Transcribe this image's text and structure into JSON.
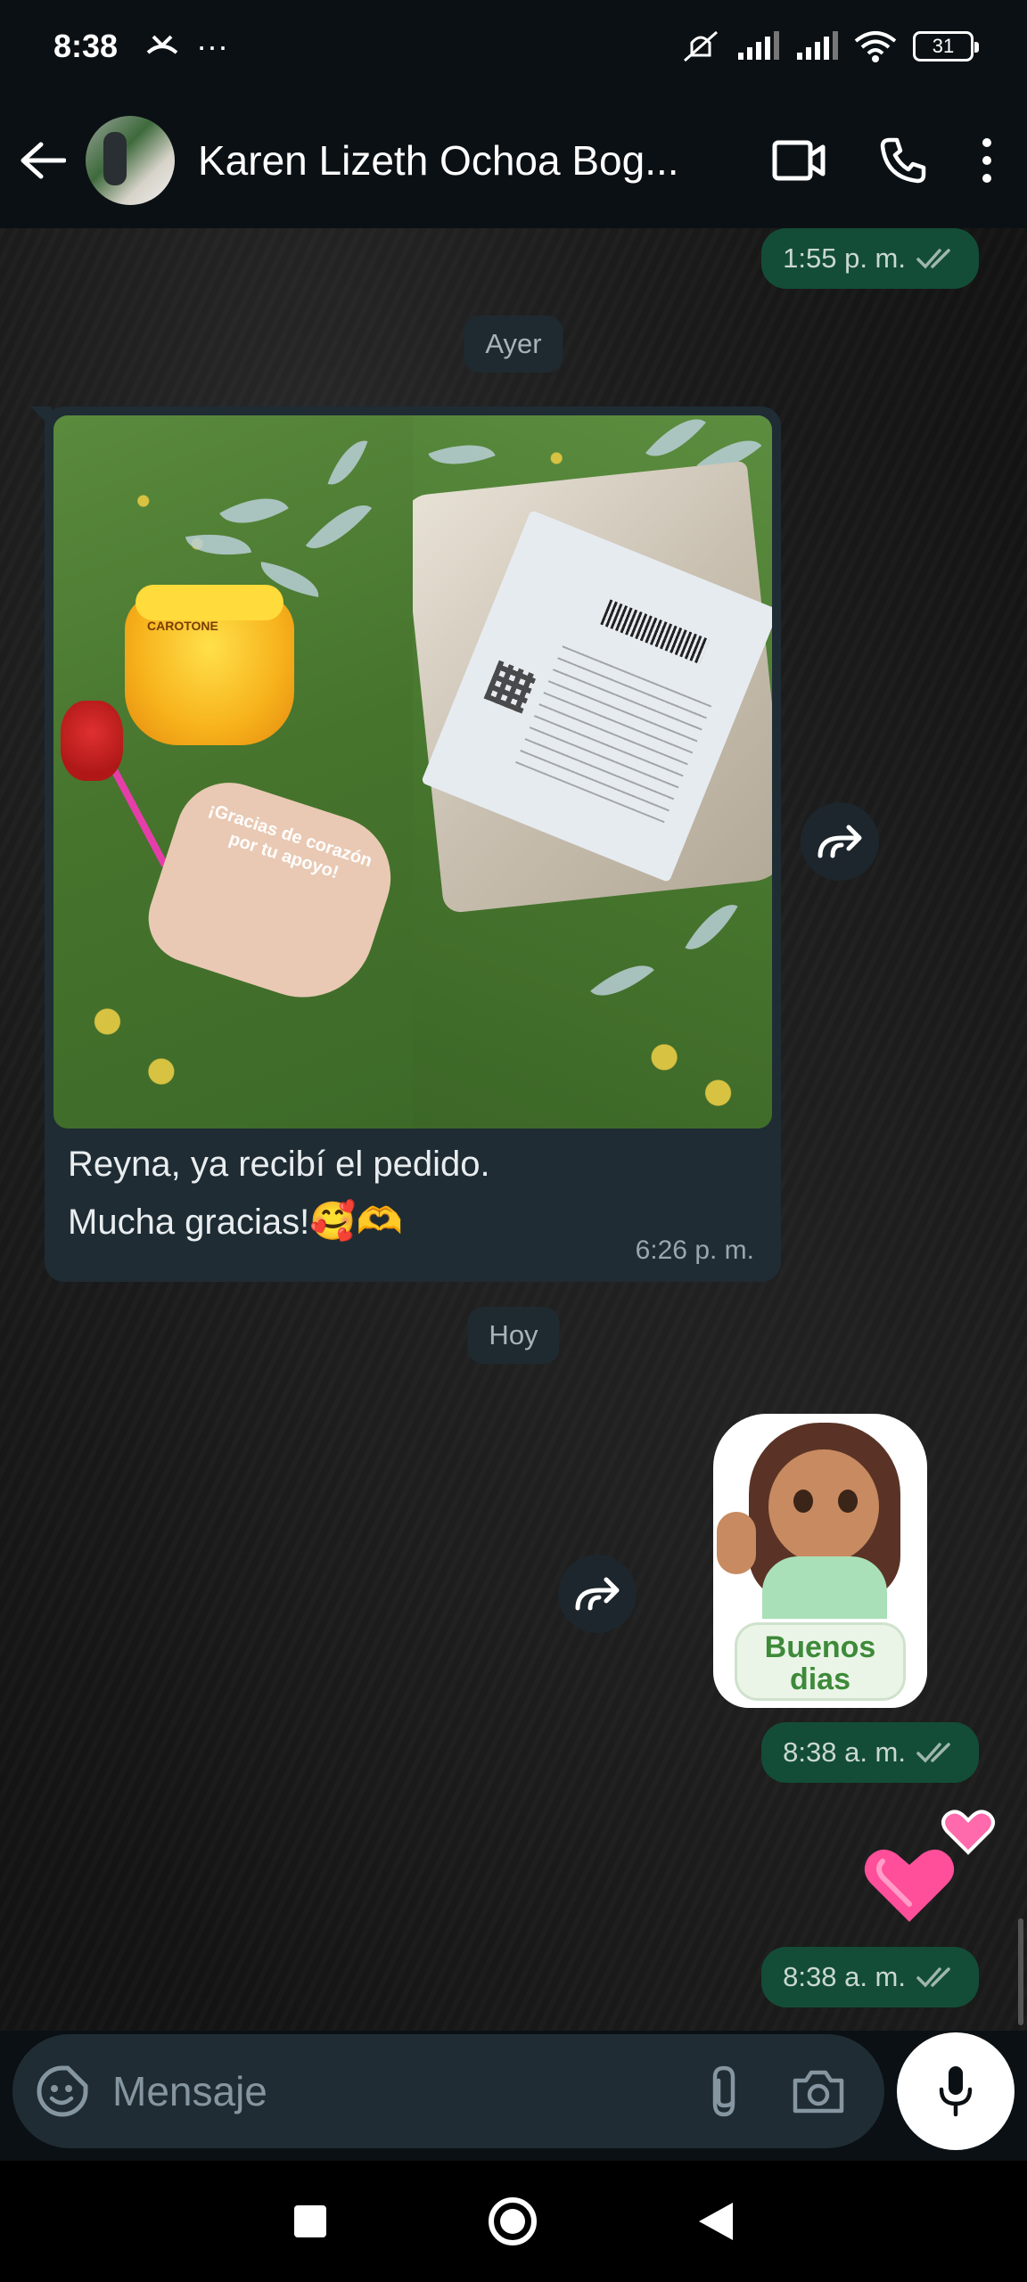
{
  "status_bar": {
    "time": "8:38",
    "more": "···",
    "battery": "31"
  },
  "header": {
    "contact_name": "Karen Lizeth Ochoa Bog..."
  },
  "chat": {
    "top_time": "1:55 p. m.",
    "date_yesterday": "Ayer",
    "incoming_message": {
      "line1": "Reyna, ya recibí el pedido.",
      "line2": "Mucha gracias!",
      "emoji": "🥰🫶",
      "time": "6:26 p. m.",
      "photo_left_card_title": "¡Gracias de corazón por tu apoyo!",
      "photo_left_jar_label": "CAROTONE"
    },
    "date_today": "Hoy",
    "sticker": {
      "label_line1": "Buenos",
      "label_line2": "dias",
      "time": "8:38 a. m."
    },
    "hearts": {
      "time": "8:38 a. m."
    }
  },
  "composer": {
    "placeholder": "Mensaje"
  }
}
